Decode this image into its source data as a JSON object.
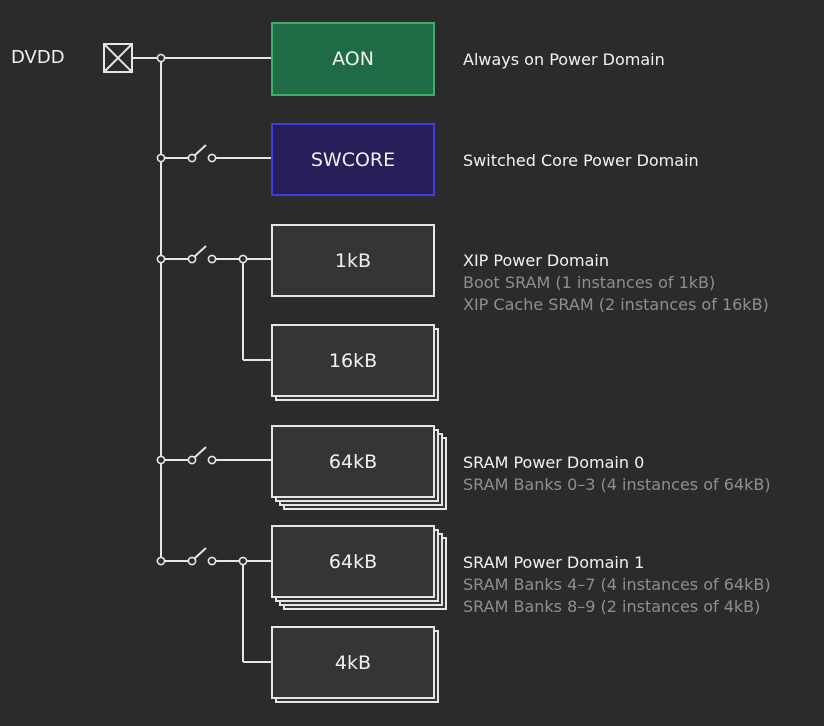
{
  "supply": {
    "label": "DVDD"
  },
  "colors": {
    "background": "#2b2b2b",
    "wire": "#e6e6e6",
    "aon_fill": "#1f6b45",
    "aon_border": "#3fae6a",
    "swcore_fill": "#261f5a",
    "swcore_border": "#3c3ce0",
    "muted_text": "#8f8f8f"
  },
  "domains": [
    {
      "blocks": [
        "AON"
      ],
      "title": "Always on Power Domain",
      "details": []
    },
    {
      "blocks": [
        "SWCORE"
      ],
      "title": "Switched Core Power Domain",
      "details": []
    },
    {
      "blocks": [
        "1kB",
        "16kB"
      ],
      "title": "XIP Power Domain",
      "details": [
        "Boot SRAM (1 instances of 1kB)",
        "XIP Cache SRAM (2 instances of 16kB)"
      ]
    },
    {
      "blocks": [
        "64kB"
      ],
      "title": "SRAM Power Domain 0",
      "details": [
        "SRAM Banks 0–3 (4 instances of 64kB)"
      ]
    },
    {
      "blocks": [
        "64kB",
        "4kB"
      ],
      "title": "SRAM Power Domain 1",
      "details": [
        "SRAM Banks 4–7 (4 instances of 64kB)",
        "SRAM Banks 8–9 (2 instances of 4kB)"
      ]
    }
  ]
}
